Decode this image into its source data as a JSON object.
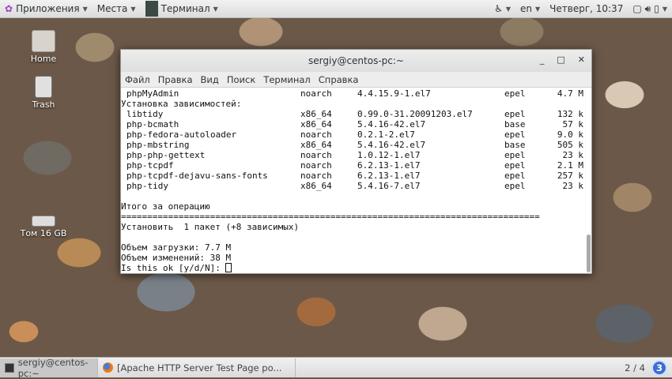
{
  "topbar": {
    "apps": "Приложения",
    "places": "Места",
    "terminal": "Терминал",
    "lang": "en",
    "clock": "Четверг, 10:37"
  },
  "desktop": {
    "home": "Home",
    "trash": "Trash",
    "volume": "Том 16 GB"
  },
  "window": {
    "title": "sergiy@centos-pc:~",
    "menu": [
      "Файл",
      "Правка",
      "Вид",
      "Поиск",
      "Терминал",
      "Справка"
    ]
  },
  "terminal": {
    "main_pkg": {
      "name": "phpMyAdmin",
      "arch": "noarch",
      "version": "4.4.15.9-1.el7",
      "repo": "epel",
      "size": "4.7 M"
    },
    "deps_header": "Установка зависимостей:",
    "deps": [
      {
        "name": "libtidy",
        "arch": "x86_64",
        "version": "0.99.0-31.20091203.el7",
        "repo": "epel",
        "size": "132 k"
      },
      {
        "name": "php-bcmath",
        "arch": "x86_64",
        "version": "5.4.16-42.el7",
        "repo": "base",
        "size": "57 k"
      },
      {
        "name": "php-fedora-autoloader",
        "arch": "noarch",
        "version": "0.2.1-2.el7",
        "repo": "epel",
        "size": "9.0 k"
      },
      {
        "name": "php-mbstring",
        "arch": "x86_64",
        "version": "5.4.16-42.el7",
        "repo": "base",
        "size": "505 k"
      },
      {
        "name": "php-php-gettext",
        "arch": "noarch",
        "version": "1.0.12-1.el7",
        "repo": "epel",
        "size": "23 k"
      },
      {
        "name": "php-tcpdf",
        "arch": "noarch",
        "version": "6.2.13-1.el7",
        "repo": "epel",
        "size": "2.1 M"
      },
      {
        "name": "php-tcpdf-dejavu-sans-fonts",
        "arch": "noarch",
        "version": "6.2.13-1.el7",
        "repo": "epel",
        "size": "257 k"
      },
      {
        "name": "php-tidy",
        "arch": "x86_64",
        "version": "5.4.16-7.el7",
        "repo": "epel",
        "size": "23 k"
      }
    ],
    "summary": "Итого за операцию",
    "separator": "================================================================================",
    "install": "Установить  1 пакет (+8 зависимых)",
    "download": "Объем загрузки: 7.7 M",
    "change": "Объем изменений: 38 M",
    "prompt": "Is this ok [y/d/N]: "
  },
  "taskbar": {
    "task1": "sergiy@centos-pc:~",
    "task2": "[Apache HTTP Server Test Page po...",
    "workspace": "2 / 4",
    "badge": "3"
  }
}
